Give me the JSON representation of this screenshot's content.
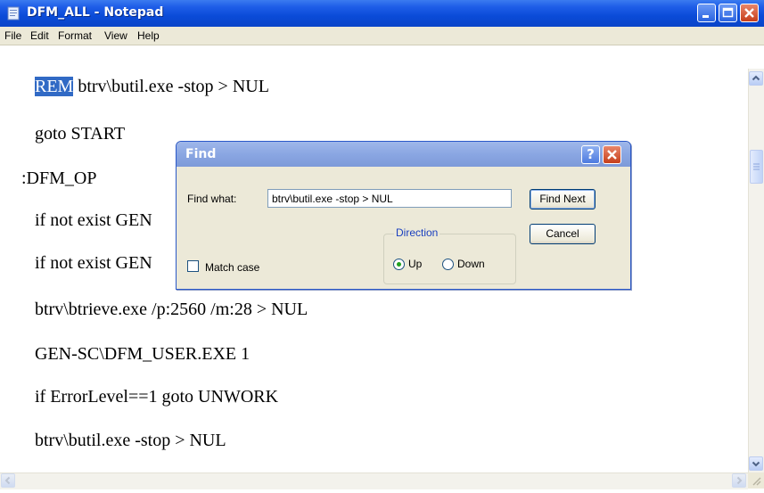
{
  "window": {
    "title": "DFM_ALL - Notepad",
    "colors": {
      "titlebar": "#0a4bd8",
      "selection": "#316ac5"
    }
  },
  "menu": {
    "items": [
      "File",
      "Edit",
      "Format",
      "View",
      "Help"
    ]
  },
  "editor": {
    "lines": [
      {
        "selected": "REM",
        "rest": " btrv\\butil.exe -stop > NUL"
      },
      {
        "text": "goto START"
      },
      {
        "text": ":DFM_OP"
      },
      {
        "text": "if not exist GEN"
      },
      {
        "text": "if not exist GEN"
      },
      {
        "text": "btrv\\btrieve.exe /p:2560 /m:28 > NUL"
      },
      {
        "text": "GEN-SC\\DFM_USER.EXE 1"
      },
      {
        "text": "if ErrorLevel==1 goto UNWORK"
      },
      {
        "text": "btrv\\butil.exe -stop > NUL"
      }
    ]
  },
  "find_dialog": {
    "title": "Find",
    "help_label": "?",
    "find_what_label": "Find what:",
    "find_what_value": "btrv\\butil.exe -stop > NUL",
    "find_next_label": "Find Next",
    "cancel_label": "Cancel",
    "direction_label": "Direction",
    "up_label": "Up",
    "down_label": "Down",
    "direction_selected": "Up",
    "match_case_label": "Match case",
    "match_case_checked": false
  }
}
